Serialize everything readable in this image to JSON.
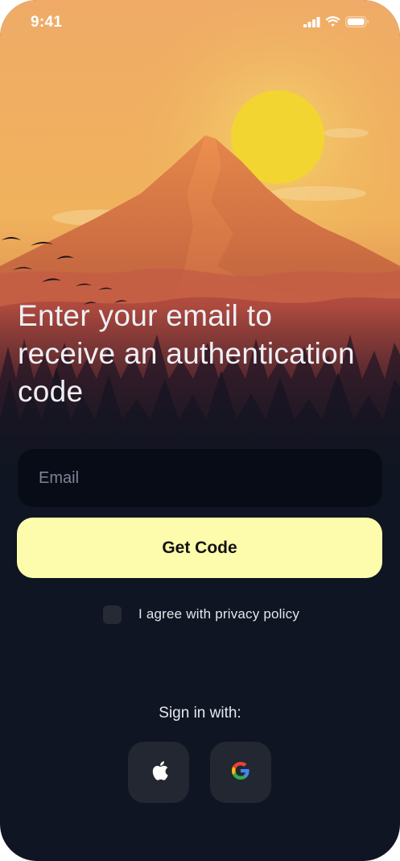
{
  "status_bar": {
    "time": "9:41",
    "icons": [
      "signal-icon",
      "wifi-icon",
      "battery-icon"
    ]
  },
  "auth": {
    "headline": "Enter your email to receive an authentication code",
    "email_placeholder": "Email",
    "email_value": "",
    "submit_label": "Get Code",
    "privacy_label": "I agree with privacy policy",
    "privacy_checked": false
  },
  "social": {
    "label": "Sign in with:",
    "providers": [
      {
        "name": "Apple",
        "icon": "apple-icon"
      },
      {
        "name": "Google",
        "icon": "google-icon"
      }
    ]
  },
  "colors": {
    "background": "#0f1522",
    "accent": "#fdfcac",
    "input_bg": "#070c17",
    "social_bg": "#222731",
    "sky_top": "#efad66",
    "sun": "#f3d531"
  }
}
